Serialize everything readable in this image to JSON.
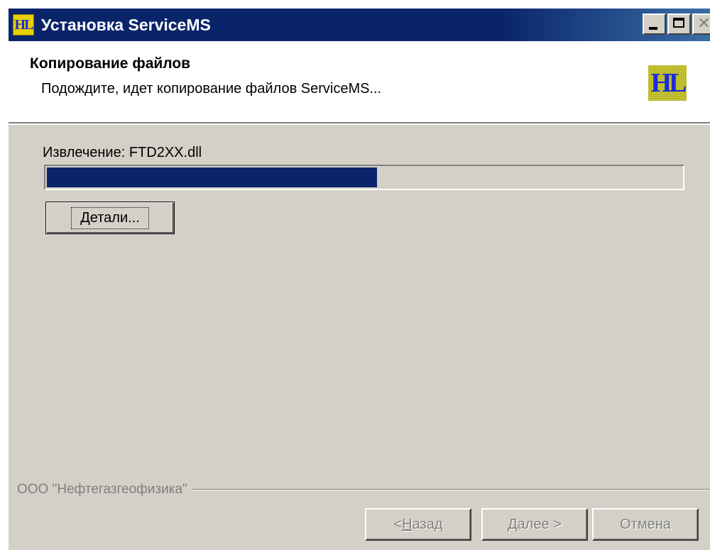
{
  "window": {
    "title": "Установка ServiceMS",
    "icon_text": "HL"
  },
  "header": {
    "title": "Копирование файлов",
    "subtitle": "Подождите, идет копирование файлов ServiceMS...",
    "logo_text": "HL"
  },
  "status": {
    "label": "Извлечение: FTD2XX.dll",
    "progress_fraction": 0.52
  },
  "details_button": {
    "mnemonic": "Д",
    "rest": "етали..."
  },
  "footer": {
    "brand": "ООО \"Нефтегазгеофизика\"",
    "back_prefix": "< ",
    "back_mnemonic": "Н",
    "back_rest": "азад",
    "next_mnemonic": "Д",
    "next_rest": "алее >",
    "cancel_label": "Отмена"
  },
  "colors": {
    "titlebar": "#0a246a",
    "progress": "#0a246a",
    "face": "#d4d0c8"
  },
  "icons": {
    "minimize": "minimize-icon",
    "maximize": "maximize-icon",
    "close": "close-icon"
  }
}
